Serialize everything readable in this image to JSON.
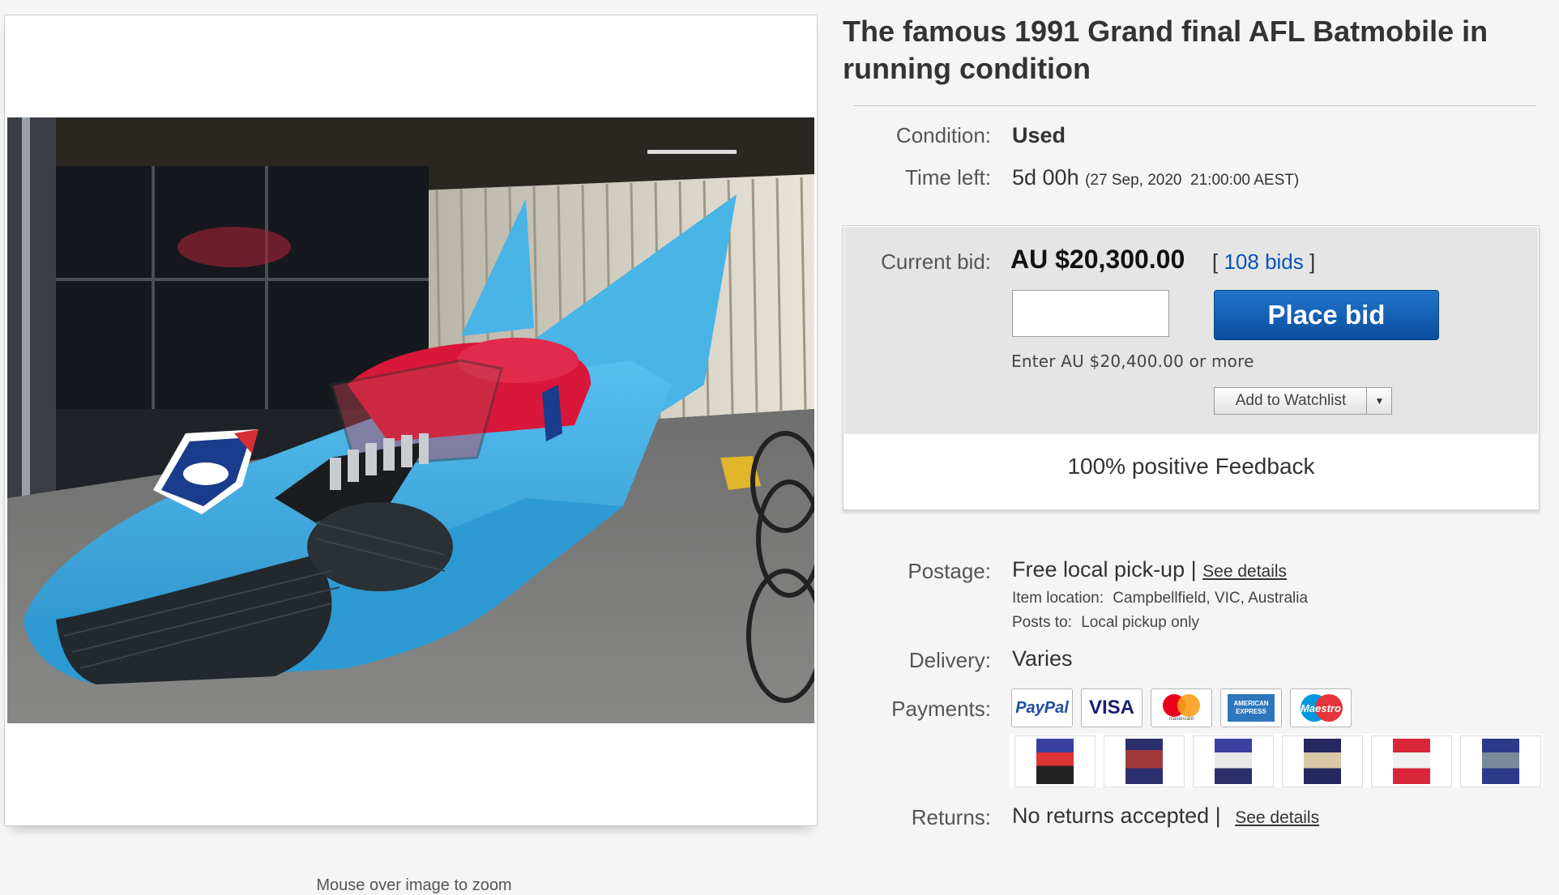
{
  "title": "The famous 1991 Grand final AFL Batmobile in running condition",
  "zoom_hint": "Mouse over image to zoom",
  "condition": {
    "label": "Condition:",
    "value": "Used"
  },
  "time_left": {
    "label": "Time left:",
    "value": "5d 00h",
    "detail": "(27 Sep, 2020  21:00:00 AEST)"
  },
  "bid": {
    "label": "Current bid:",
    "amount": "AU $20,300.00",
    "bids_open": "[",
    "bids_link": "108 bids",
    "bids_close": "]",
    "input_value": "",
    "place_bid": "Place bid",
    "hint": "Enter AU $20,400.00 or more",
    "watchlist": "Add to Watchlist",
    "feedback": "100% positive Feedback"
  },
  "postage": {
    "label": "Postage:",
    "value": "Free local pick-up",
    "separator": "|",
    "see_details": "See details",
    "location_label": "Item location:",
    "location": "Campbellfield, VIC, Australia",
    "posts_label": "Posts to:",
    "posts": "Local pickup only"
  },
  "delivery": {
    "label": "Delivery:",
    "value": "Varies"
  },
  "payments": {
    "label": "Payments:",
    "methods": [
      "PayPal",
      "VISA",
      "mastercard",
      "AMERICAN EXPRESS",
      "Maestro"
    ]
  },
  "returns": {
    "label": "Returns:",
    "value": "No returns accepted",
    "separator": "|",
    "see_details": "See details"
  },
  "colors": {
    "accent_blue": "#0654ba",
    "button_blue": "#0a4e9e",
    "car_blue": "#3aa6d8",
    "seat_red": "#d8173a"
  }
}
